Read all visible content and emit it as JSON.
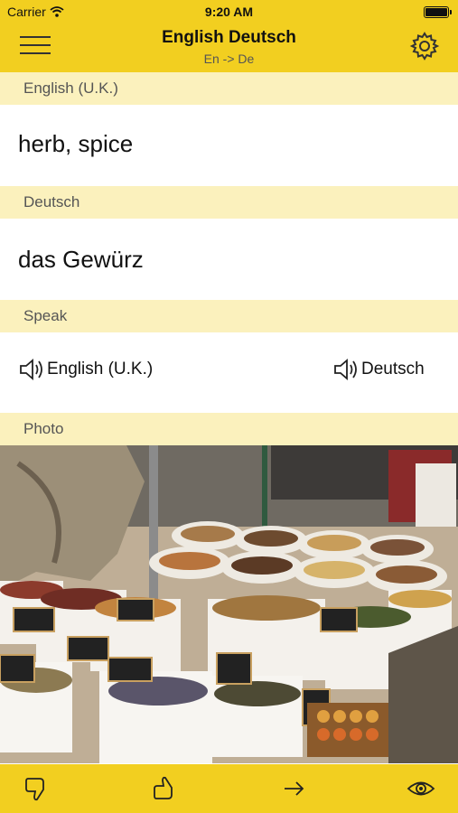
{
  "status_bar": {
    "carrier": "Carrier",
    "time": "9:20 AM"
  },
  "header": {
    "title": "English Deutsch",
    "subtitle": "En -> De"
  },
  "sections": {
    "source_label": "English (U.K.)",
    "source_word": "herb, spice",
    "target_label": "Deutsch",
    "target_word": "das Gewürz",
    "speak_label": "Speak",
    "photo_label": "Photo"
  },
  "speak": {
    "source_button": "English (U.K.)",
    "target_button": "Deutsch"
  },
  "toolbar": {
    "icons": [
      "thumbs-down-icon",
      "thumbs-up-icon",
      "arrow-right-icon",
      "eye-icon"
    ]
  },
  "colors": {
    "accent": "#f2cf20",
    "label_band": "#fbf1bd"
  }
}
